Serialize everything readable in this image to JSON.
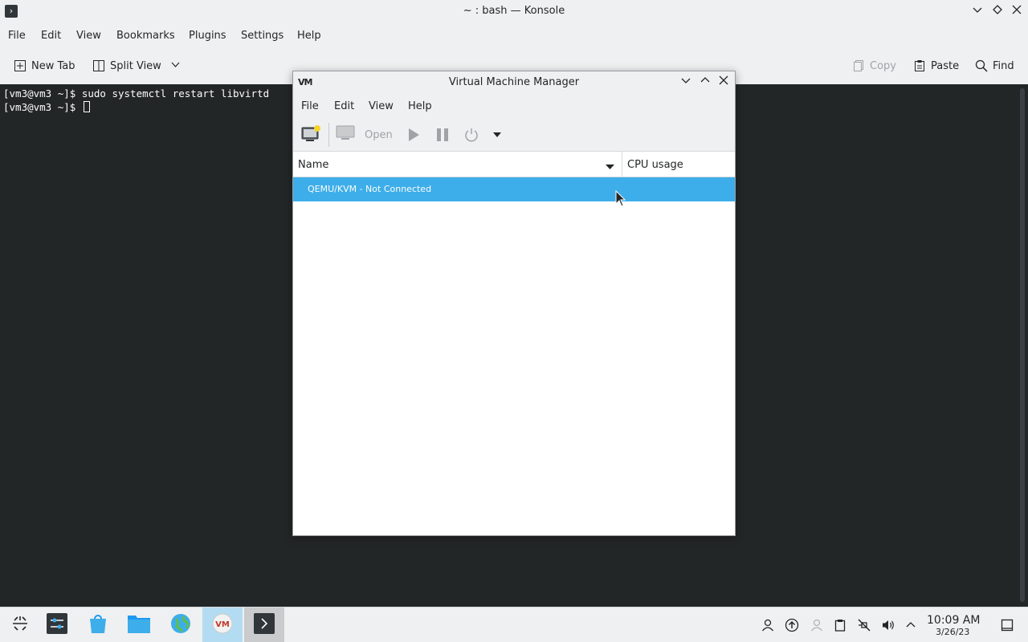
{
  "konsole": {
    "title": "~ : bash — Konsole",
    "menu": [
      "File",
      "Edit",
      "View",
      "Bookmarks",
      "Plugins",
      "Settings",
      "Help"
    ],
    "toolbar": {
      "new_tab": "New Tab",
      "split_view": "Split View",
      "copy": "Copy",
      "paste": "Paste",
      "find": "Find"
    },
    "terminal_lines": [
      "[vm3@vm3 ~]$ sudo systemctl restart libvirtd",
      "[vm3@vm3 ~]$ "
    ]
  },
  "vmm": {
    "title": "Virtual Machine Manager",
    "menu": [
      "File",
      "Edit",
      "View",
      "Help"
    ],
    "toolbar": {
      "open": "Open"
    },
    "columns": {
      "name": "Name",
      "cpu": "CPU usage"
    },
    "rows": [
      {
        "name": "QEMU/KVM - Not Connected"
      }
    ]
  },
  "taskbar": {
    "clock_time": "10:09 AM",
    "clock_date": "3/26/23"
  },
  "colors": {
    "selection": "#3daee9",
    "terminal_bg": "#232627",
    "panel_bg": "#eff0f1"
  }
}
